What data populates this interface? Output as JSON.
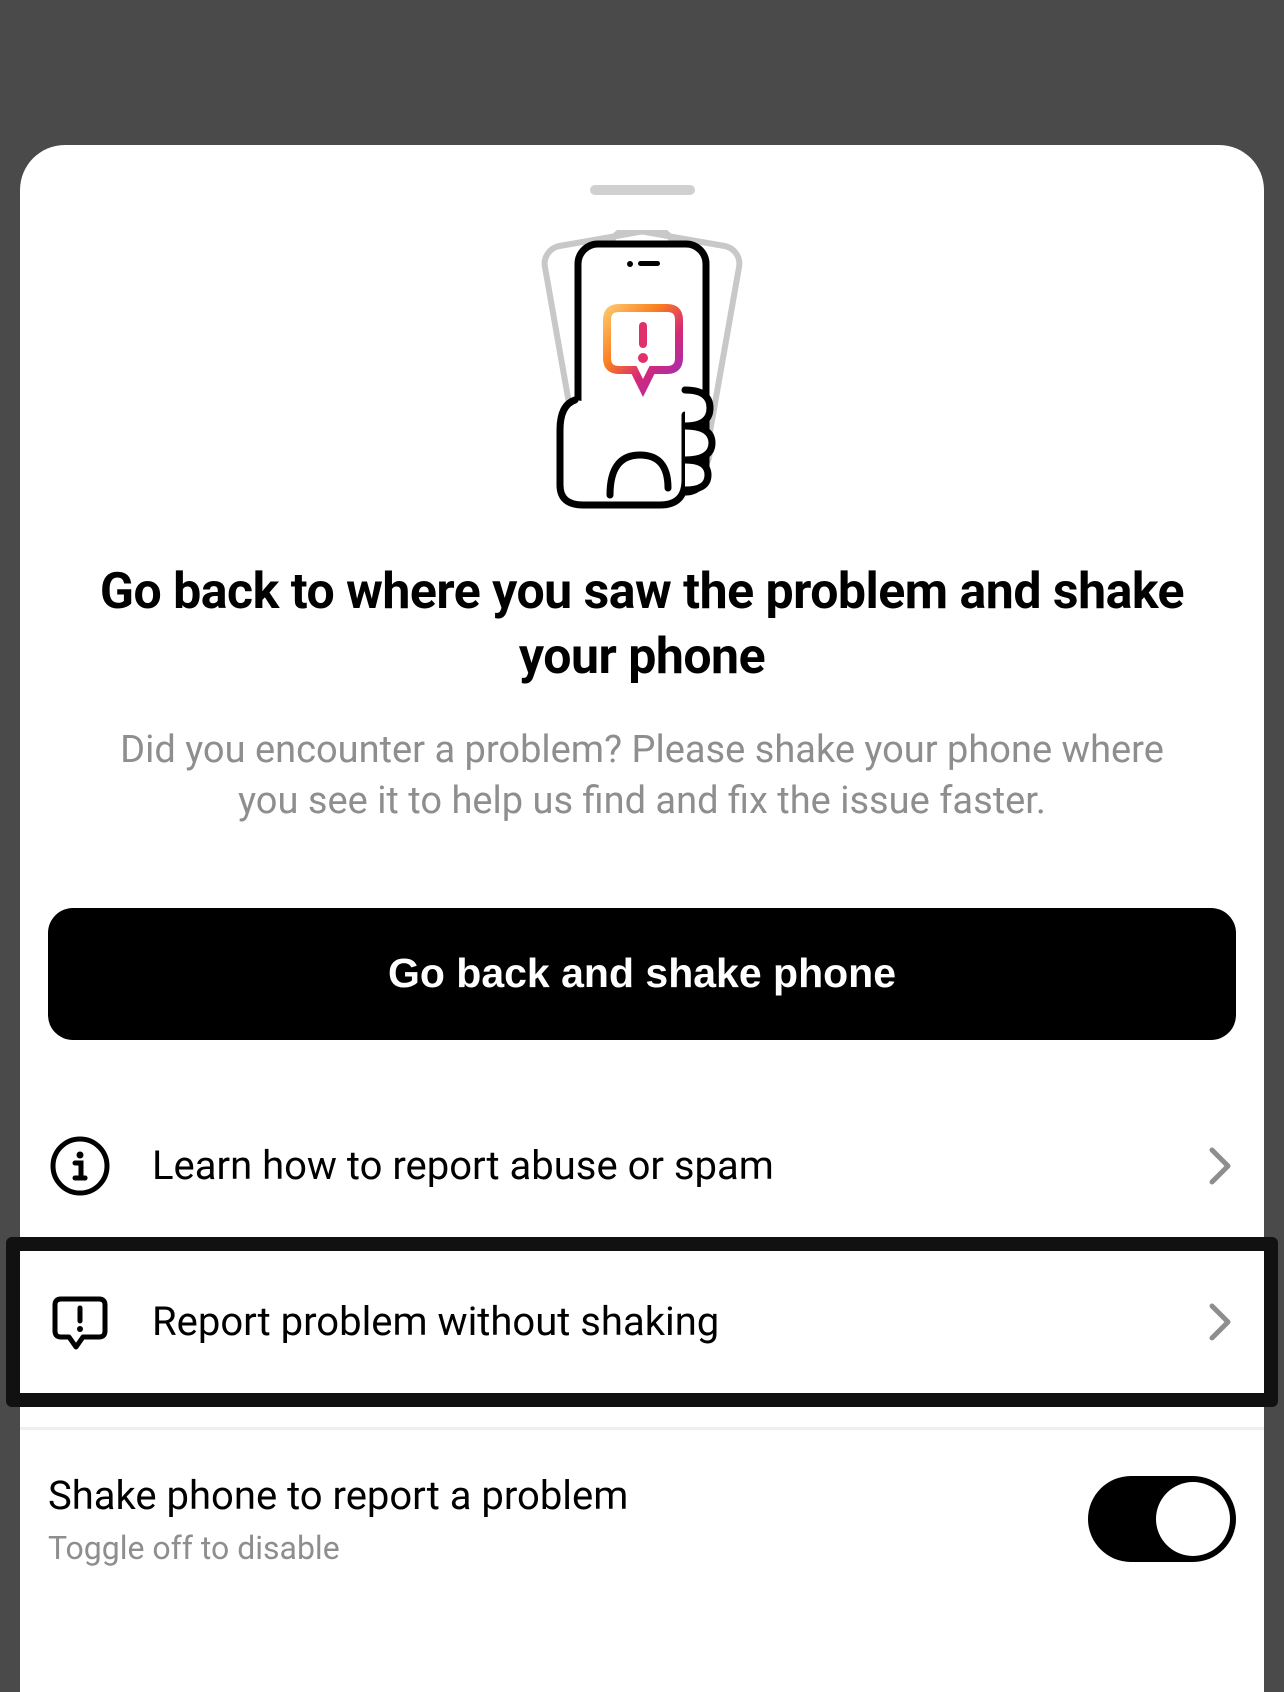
{
  "heading": "Go back to where you saw the problem and shake your phone",
  "subtext": "Did you encounter a problem? Please shake your phone where you see it to help us find and fix the issue faster.",
  "primary_button": "Go back and shake phone",
  "rows": {
    "learn": "Learn how to report abuse or spam",
    "report": "Report problem without shaking"
  },
  "toggle": {
    "title": "Shake phone to report a problem",
    "subtitle": "Toggle off to disable",
    "enabled": true
  }
}
